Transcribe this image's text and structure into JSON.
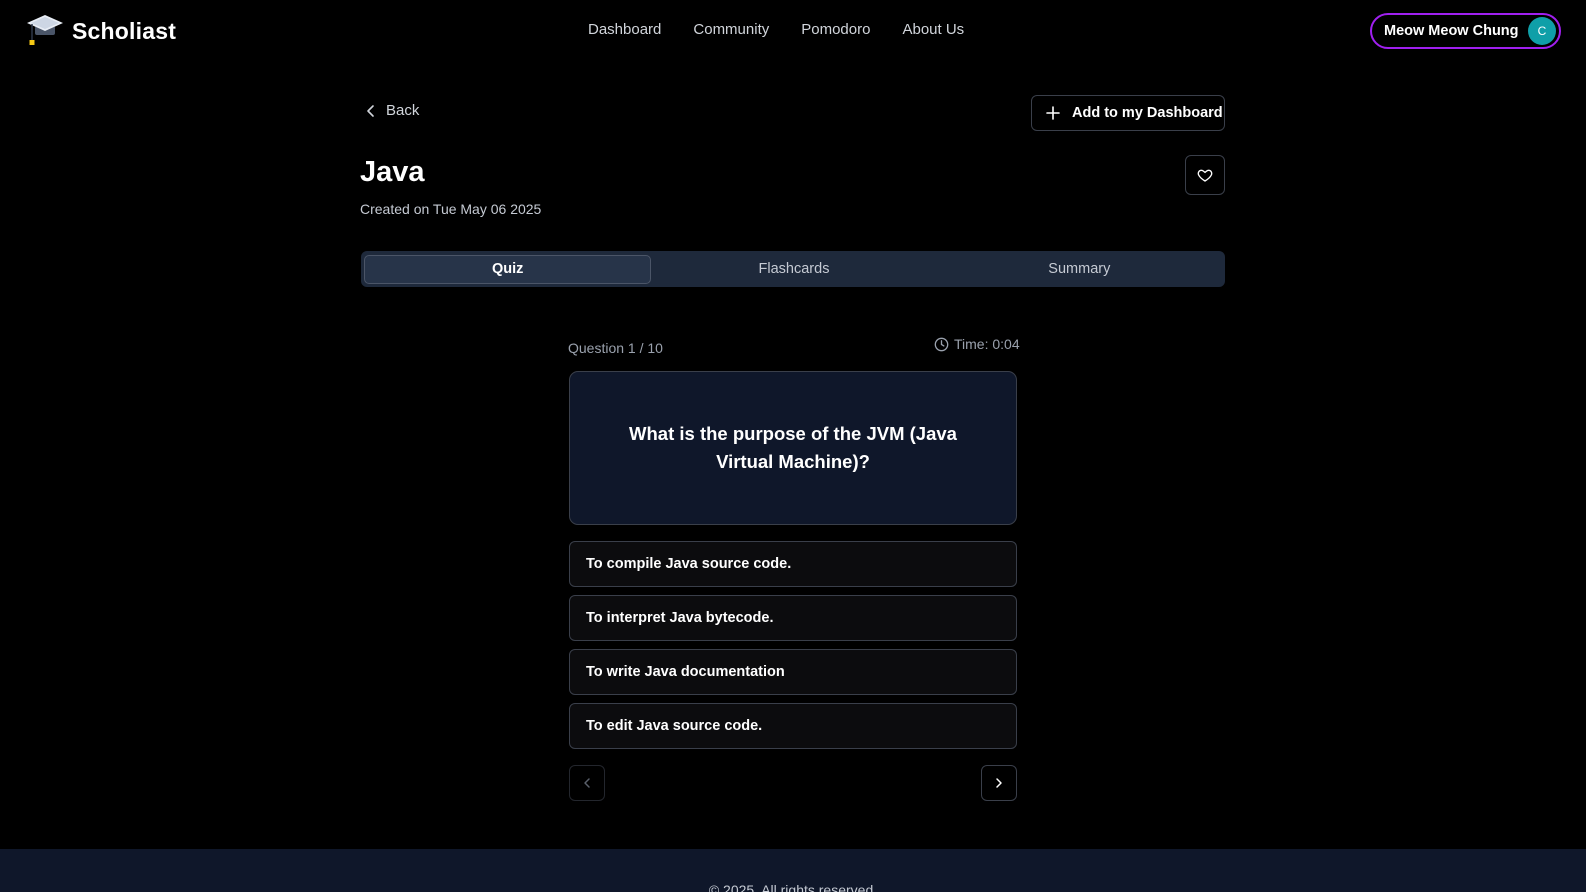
{
  "header": {
    "brand": "Scholiast",
    "nav": [
      "Dashboard",
      "Community",
      "Pomodoro",
      "About Us"
    ],
    "user": {
      "name": "Meow Meow Chung",
      "initial": "C",
      "avatar_color": "#0f9fa8",
      "ring_color": "#a020f0"
    }
  },
  "page": {
    "back_label": "Back",
    "add_label": "Add to my Dashboard",
    "title": "Java",
    "created": "Created on Tue May 06 2025"
  },
  "tabs": [
    {
      "label": "Quiz",
      "active": true
    },
    {
      "label": "Flashcards",
      "active": false
    },
    {
      "label": "Summary",
      "active": false
    }
  ],
  "quiz": {
    "counter": "Question 1 / 10",
    "timer": "Time: 0:04",
    "question": "What is the purpose of the JVM (Java Virtual Machine)?",
    "options": [
      "To compile Java source code.",
      "To interpret Java bytecode.",
      "To write Java documentation",
      "To edit Java source code."
    ]
  },
  "footer": {
    "text": "© 2025. All rights reserved."
  }
}
